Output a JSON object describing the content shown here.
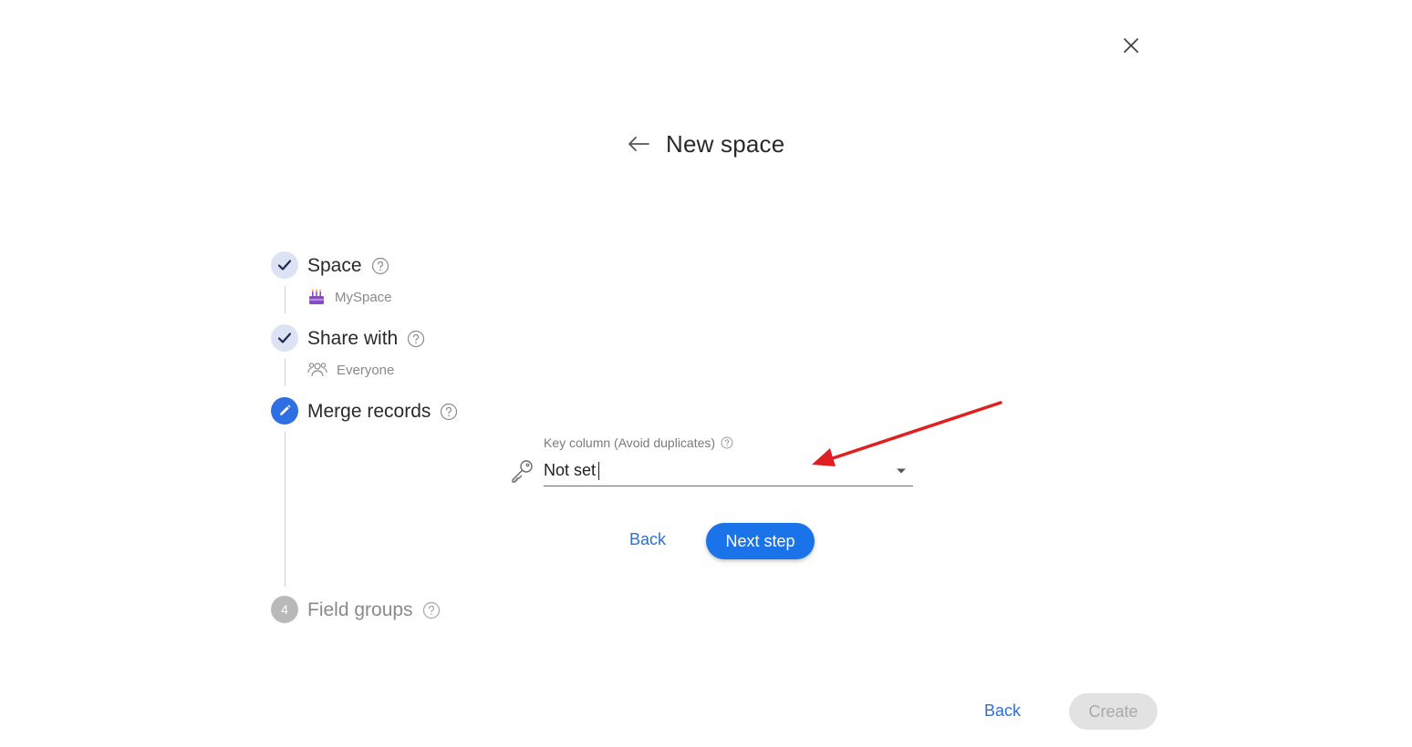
{
  "header": {
    "title": "New space"
  },
  "steps": [
    {
      "label": "Space",
      "status": "done",
      "sub": {
        "text": "MySpace",
        "icon": "cake-icon"
      }
    },
    {
      "label": "Share with",
      "status": "done",
      "sub": {
        "text": "Everyone",
        "icon": "people-icon"
      }
    },
    {
      "label": "Merge records",
      "status": "active"
    },
    {
      "label": "Field groups",
      "status": "pending",
      "number": "4"
    }
  ],
  "key_column": {
    "label": "Key column (Avoid duplicates)",
    "value": "Not set"
  },
  "step_actions": {
    "back_label": "Back",
    "next_label": "Next step"
  },
  "footer": {
    "back_label": "Back",
    "create_label": "Create"
  },
  "colors": {
    "primary": "#1a73e8",
    "step_done_bg": "#dde3f4",
    "step_active": "#2f6fe4",
    "annotation_arrow": "#e02020"
  }
}
